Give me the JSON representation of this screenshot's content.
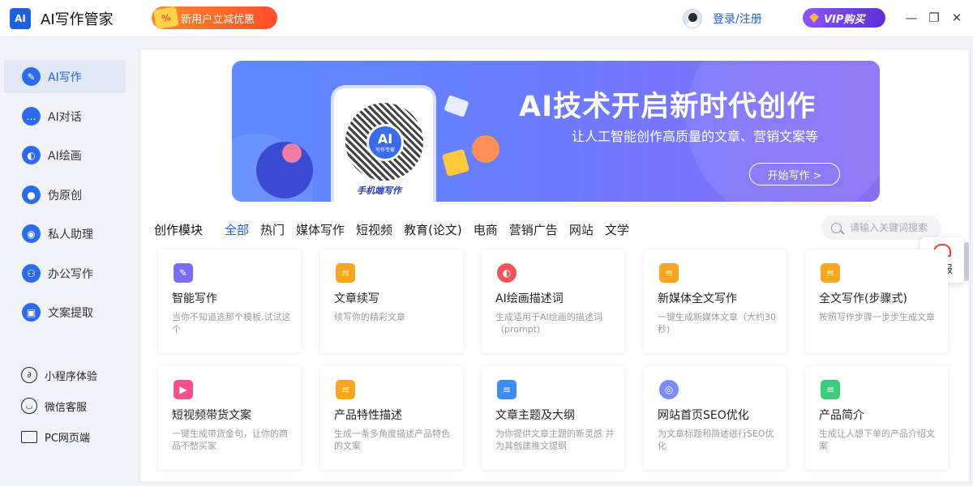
{
  "app": {
    "logo_text": "AI",
    "title": "AI写作管家"
  },
  "promo": {
    "label": "新用户立减优惠",
    "icon_text": "%"
  },
  "header": {
    "login_label": "登录/注册",
    "vip_label": "VIP购买"
  },
  "window_controls": {
    "minimize": "—",
    "restore": "❐",
    "close": "✕"
  },
  "sidebar": {
    "items": [
      {
        "label": "AI写作",
        "icon": "pen-icon",
        "glyph": "✎"
      },
      {
        "label": "AI对话",
        "icon": "chat-icon",
        "glyph": "…"
      },
      {
        "label": "AI绘画",
        "icon": "palette-icon",
        "glyph": "◐"
      },
      {
        "label": "伪原创",
        "icon": "location-icon",
        "glyph": "●"
      },
      {
        "label": "私人助理",
        "icon": "robot-icon",
        "glyph": "◉"
      },
      {
        "label": "办公写作",
        "icon": "people-icon",
        "glyph": "⚇"
      },
      {
        "label": "文案提取",
        "icon": "folder-icon",
        "glyph": "▣"
      }
    ],
    "links": [
      {
        "label": "小程序体验",
        "icon": "miniprogram-icon"
      },
      {
        "label": "微信客服",
        "icon": "wechat-icon"
      },
      {
        "label": "PC网页端",
        "icon": "monitor-icon"
      }
    ]
  },
  "banner": {
    "title": "AI技术开启新时代创作",
    "subtitle": "让人工智能创作高质量的文章、营销文案等",
    "button": "开始写作 >",
    "phone_caption": "手机端写作",
    "qr_center": "AI",
    "qr_sub": "写作专家"
  },
  "category": {
    "title": "创作模块",
    "tabs": [
      "全部",
      "热门",
      "媒体写作",
      "短视频",
      "教育(论文)",
      "电商",
      "营销广告",
      "网站",
      "文学"
    ],
    "active_tab": "全部"
  },
  "search": {
    "placeholder": "请输入关键词搜索"
  },
  "report": {
    "label": "举报"
  },
  "cards": [
    {
      "title": "智能写作",
      "desc": "当你不知道选那个模板,试试这个",
      "color": "#7b6cf6"
    },
    {
      "title": "文章续写",
      "desc": "续写你的精彩文章",
      "color": "#f6a623"
    },
    {
      "title": "AI绘画描述词",
      "desc": "生成适用于AI绘画的描述词（prompt)",
      "color": "#f2525c"
    },
    {
      "title": "新媒体全文写作",
      "desc": "一键生成新媒体文章（大约30秒)",
      "color": "#f6a623"
    },
    {
      "title": "全文写作(步骤式)",
      "desc": "按照写作步骤一步步生成文章",
      "color": "#f6a623"
    },
    {
      "title": "短视频带货文案",
      "desc": "一键生成带货金句，让你的商品不愁买家",
      "color": "#f4508e"
    },
    {
      "title": "产品特性描述",
      "desc": "生成一条多角度描述产品特色的文案",
      "color": "#f6a623"
    },
    {
      "title": "文章主题及大纲",
      "desc": "为你提供文章主题的新灵感 并为其创建推文提纲",
      "color": "#3a8df2"
    },
    {
      "title": "网站首页SEO优化",
      "desc": "为文章标题和简述进行SEO优化",
      "color": "#7b8cf6"
    },
    {
      "title": "产品简介",
      "desc": "生成让人想下单的产品介绍文案",
      "color": "#3ccd7a"
    }
  ]
}
